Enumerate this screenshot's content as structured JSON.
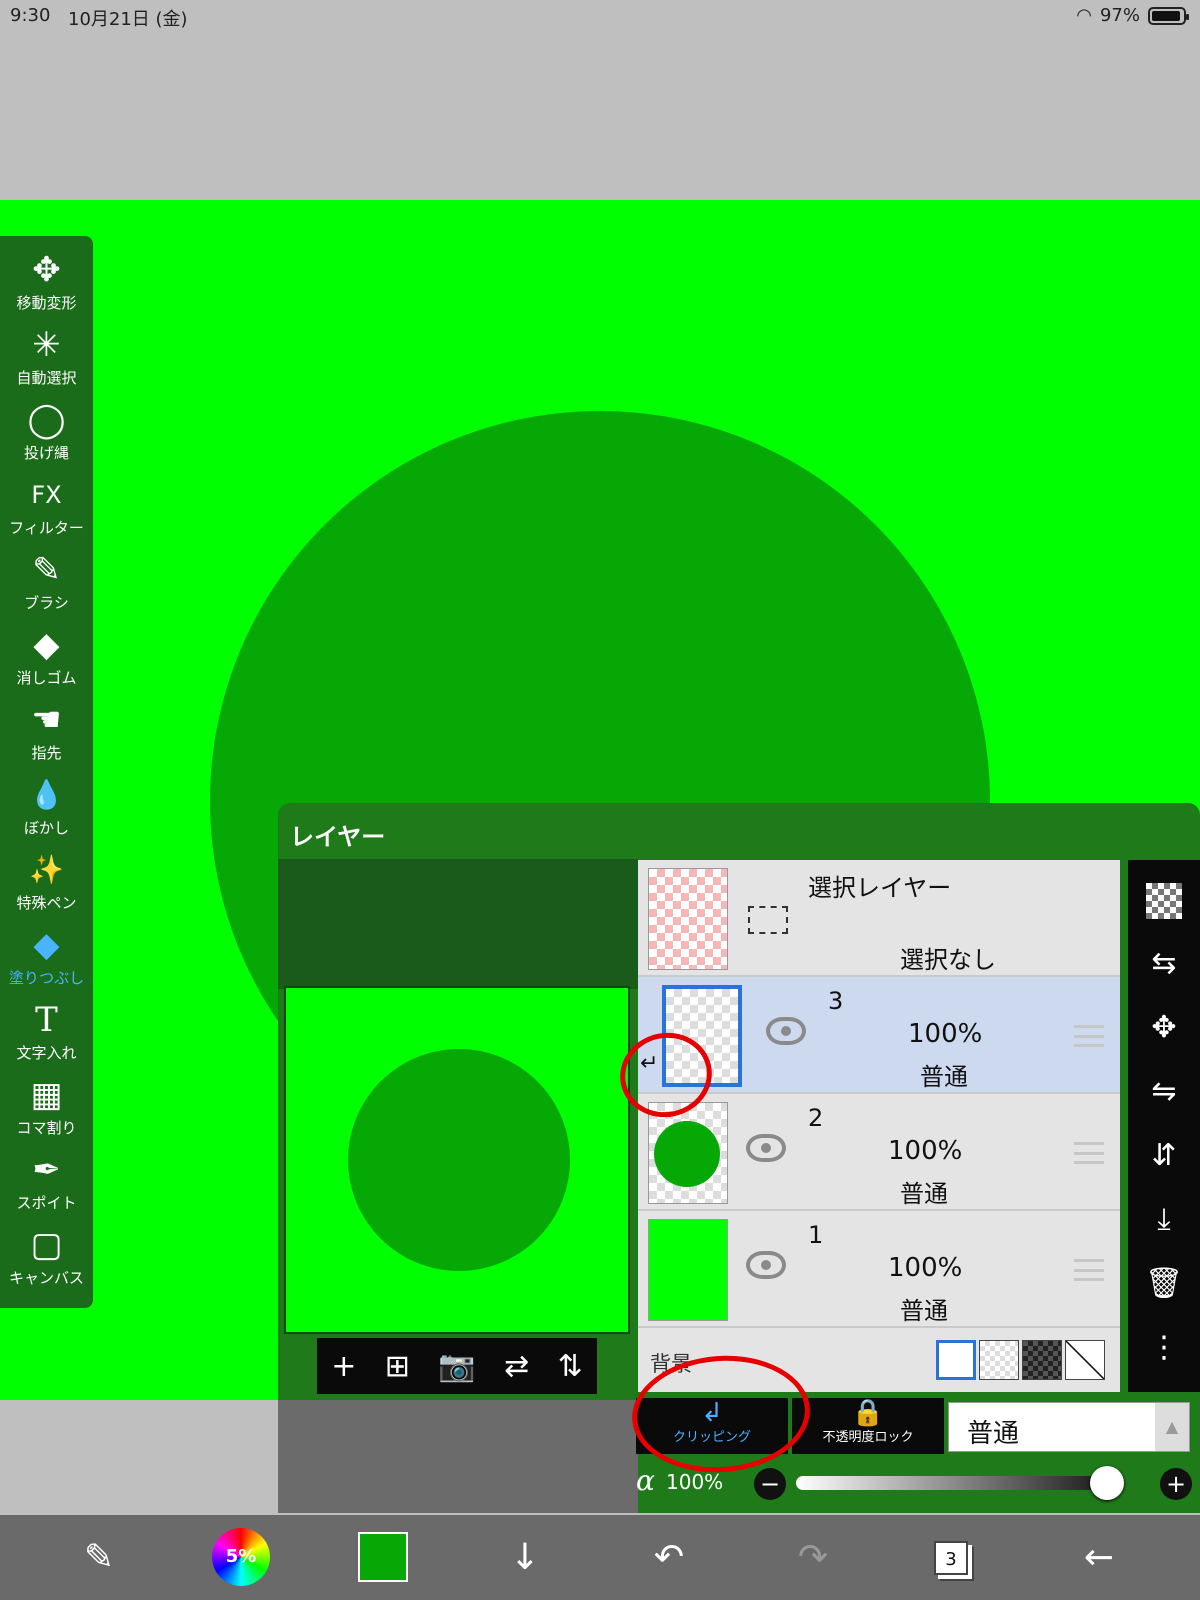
{
  "status": {
    "time": "9:30",
    "date": "10月21日 (金)",
    "battery": "97%"
  },
  "tools": [
    {
      "label": "移動変形",
      "icon": "move-icon",
      "glyph": "✥"
    },
    {
      "label": "自動選択",
      "icon": "magic-wand-icon",
      "glyph": "✳"
    },
    {
      "label": "投げ縄",
      "icon": "lasso-icon",
      "glyph": "◯"
    },
    {
      "label": "フィルター",
      "icon": "fx-icon",
      "glyph": "FX"
    },
    {
      "label": "ブラシ",
      "icon": "brush-icon",
      "glyph": "✎"
    },
    {
      "label": "消しゴム",
      "icon": "eraser-icon",
      "glyph": "◆"
    },
    {
      "label": "指先",
      "icon": "finger-icon",
      "glyph": "☚"
    },
    {
      "label": "ぼかし",
      "icon": "blur-drop-icon",
      "glyph": "💧"
    },
    {
      "label": "特殊ペン",
      "icon": "special-pen-icon",
      "glyph": "✨"
    },
    {
      "label": "塗りつぶし",
      "icon": "fill-bucket-icon",
      "glyph": "◆",
      "active": true
    },
    {
      "label": "文字入れ",
      "icon": "text-icon",
      "glyph": "T"
    },
    {
      "label": "コマ割り",
      "icon": "frame-divide-icon",
      "glyph": "▦"
    },
    {
      "label": "スポイト",
      "icon": "eyedropper-icon",
      "glyph": "✒"
    },
    {
      "label": "キャンバス",
      "icon": "canvas-icon",
      "glyph": "▢"
    }
  ],
  "layer_panel": {
    "title": "レイヤー",
    "selection_layer": {
      "title": "選択レイヤー",
      "status": "選択なし"
    },
    "layers": [
      {
        "number": "3",
        "opacity": "100%",
        "mode": "普通",
        "selected": true
      },
      {
        "number": "2",
        "opacity": "100%",
        "mode": "普通"
      },
      {
        "number": "1",
        "opacity": "100%",
        "mode": "普通"
      }
    ],
    "background_label": "背景",
    "clipping_label": "クリッピング",
    "alpha_lock_label": "不透明度ロック",
    "blend_mode": "普通",
    "alpha_symbol": "α",
    "alpha_value": "100%",
    "preview_tools": [
      "+",
      "⊞",
      "📷",
      "⇄",
      "⇅"
    ],
    "side_tools": [
      "checker",
      "⇆",
      "✥",
      "⇋",
      "⇵",
      "⤓",
      "🗑",
      "⋮"
    ]
  },
  "bottom_bar": {
    "color_wheel_text": "5%",
    "layer_count": "3"
  },
  "colors": {
    "canvas_green": "#00ff00",
    "shape_green": "#06a806",
    "accent_blue": "#4ab3ff",
    "annotation_red": "#e60000"
  }
}
